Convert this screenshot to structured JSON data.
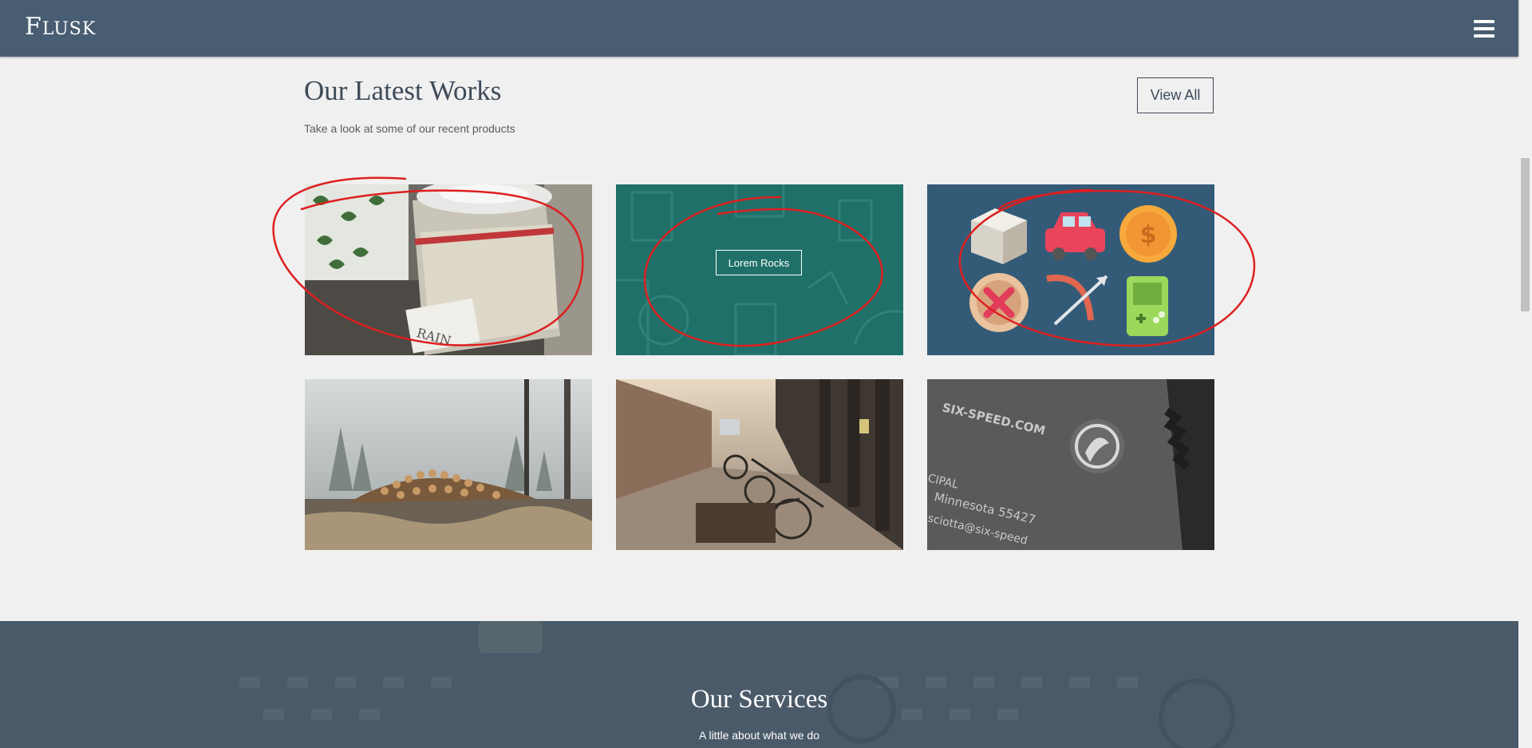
{
  "header": {
    "brand": "Flusk",
    "brand_first": "F",
    "brand_rest": "LUSK"
  },
  "works": {
    "title": "Our Latest Works",
    "subtitle": "Take a look at some of our recent products",
    "view_all_label": "View All",
    "items": [
      {
        "subject": "jar"
      },
      {
        "subject": "teal-pattern",
        "button_label": "Lorem Rocks"
      },
      {
        "subject": "flat-icons"
      },
      {
        "subject": "log-pile"
      },
      {
        "subject": "bicycle-street"
      },
      {
        "subject": "business-card",
        "card_lines": [
          "SIX-SPEED.COM",
          "CIPAL",
          "Minnesota 55427",
          "sciotta@six-speed"
        ]
      }
    ]
  },
  "services": {
    "title": "Our Services",
    "subtitle": "A little about what we do"
  },
  "colors": {
    "navbar": "#485d72",
    "background": "#f0f0f0",
    "annotation": "#dd1f1f"
  }
}
